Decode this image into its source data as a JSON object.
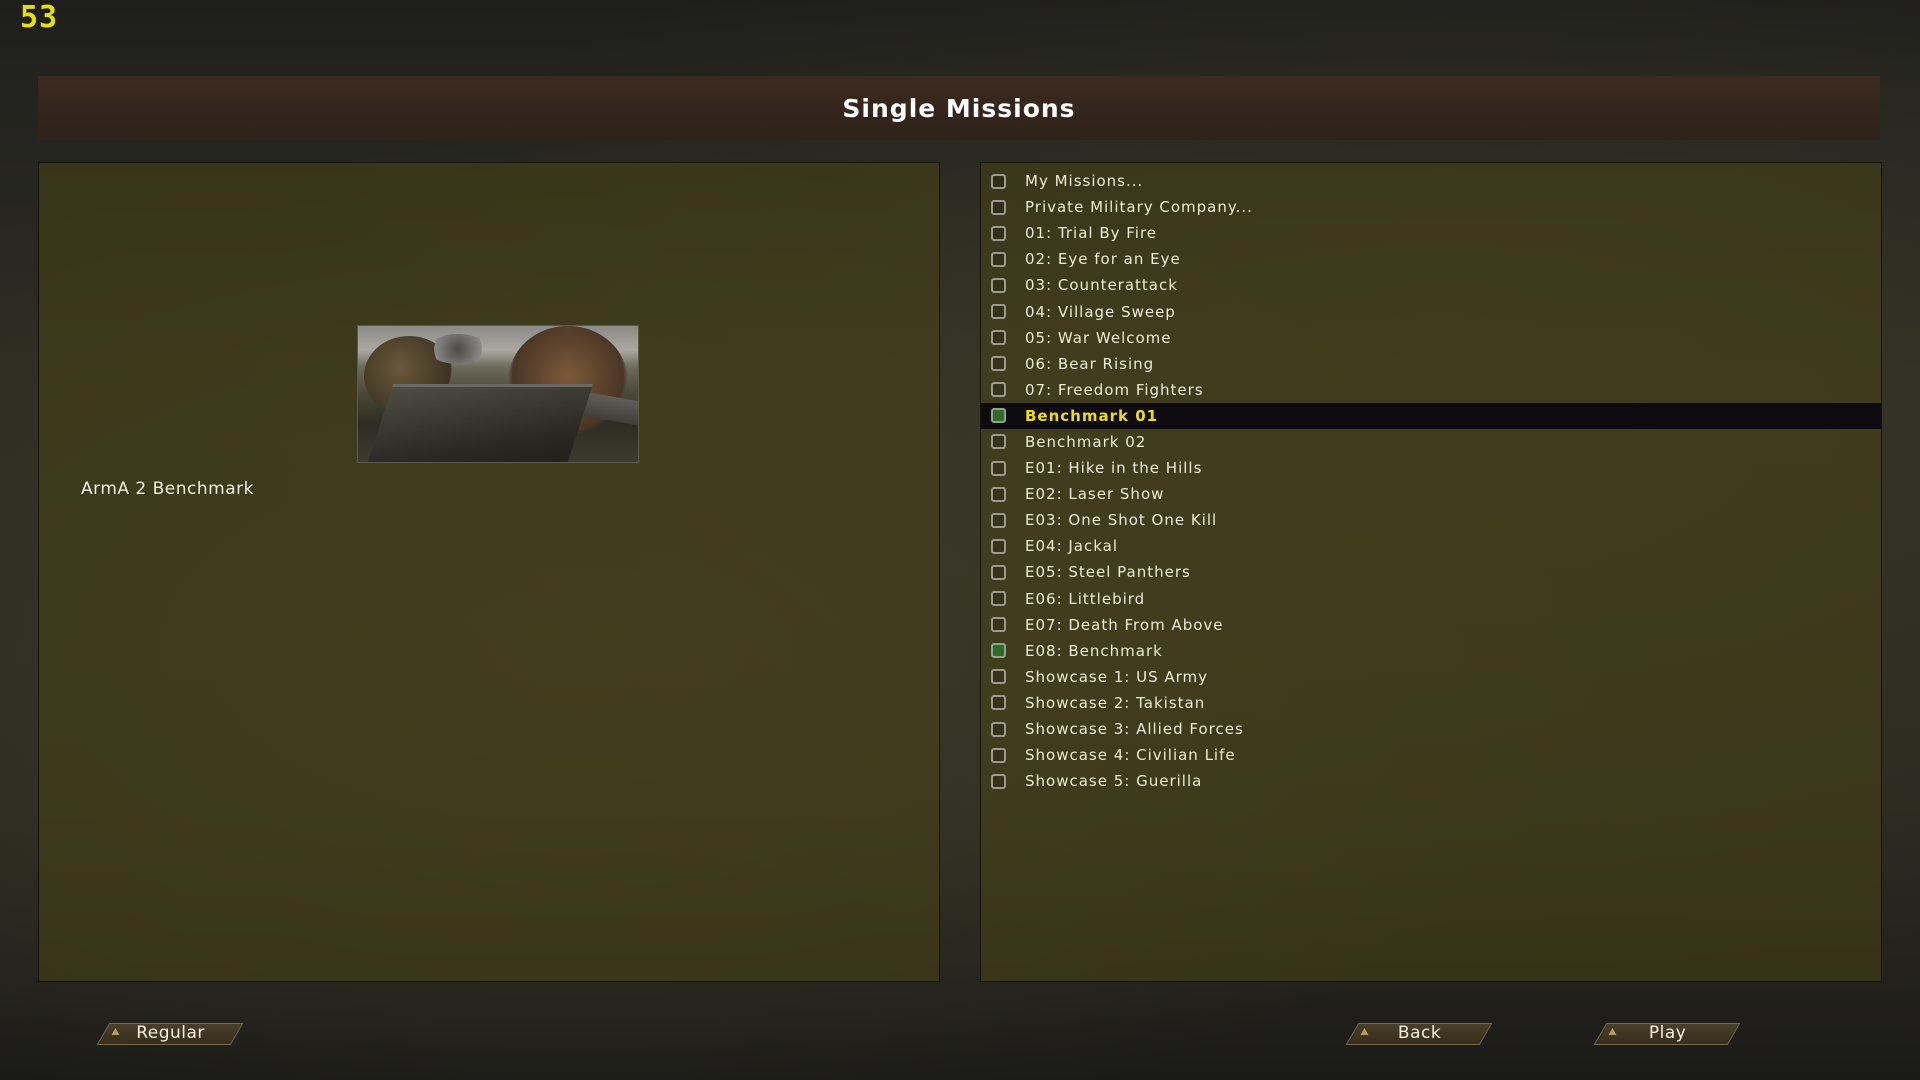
{
  "fps": "53",
  "title": "Single Missions",
  "left_panel": {
    "mission_description": "ArmA 2 Benchmark"
  },
  "missions": [
    {
      "label": "My Missions...",
      "completed": false,
      "selected": false
    },
    {
      "label": "Private Military Company...",
      "completed": false,
      "selected": false
    },
    {
      "label": "01: Trial By Fire",
      "completed": false,
      "selected": false
    },
    {
      "label": "02: Eye for an Eye",
      "completed": false,
      "selected": false
    },
    {
      "label": "03: Counterattack",
      "completed": false,
      "selected": false
    },
    {
      "label": "04: Village Sweep",
      "completed": false,
      "selected": false
    },
    {
      "label": "05: War Welcome",
      "completed": false,
      "selected": false
    },
    {
      "label": "06: Bear Rising",
      "completed": false,
      "selected": false
    },
    {
      "label": "07: Freedom Fighters",
      "completed": false,
      "selected": false
    },
    {
      "label": "Benchmark 01",
      "completed": true,
      "selected": true
    },
    {
      "label": "Benchmark 02",
      "completed": false,
      "selected": false
    },
    {
      "label": "E01: Hike in the Hills",
      "completed": false,
      "selected": false
    },
    {
      "label": "E02: Laser Show",
      "completed": false,
      "selected": false
    },
    {
      "label": "E03: One Shot One Kill",
      "completed": false,
      "selected": false
    },
    {
      "label": "E04: Jackal",
      "completed": false,
      "selected": false
    },
    {
      "label": "E05: Steel Panthers",
      "completed": false,
      "selected": false
    },
    {
      "label": "E06: Littlebird",
      "completed": false,
      "selected": false
    },
    {
      "label": "E07: Death From Above",
      "completed": false,
      "selected": false
    },
    {
      "label": "E08: Benchmark",
      "completed": true,
      "selected": false
    },
    {
      "label": "Showcase 1: US Army",
      "completed": false,
      "selected": false
    },
    {
      "label": "Showcase 2: Takistan",
      "completed": false,
      "selected": false
    },
    {
      "label": "Showcase 3: Allied Forces",
      "completed": false,
      "selected": false
    },
    {
      "label": "Showcase 4: Civilian Life",
      "completed": false,
      "selected": false
    },
    {
      "label": "Showcase 5: Guerilla",
      "completed": false,
      "selected": false
    }
  ],
  "buttons": {
    "difficulty": "Regular",
    "back": "Back",
    "play": "Play"
  },
  "colors": {
    "fps_color": "#e8e000",
    "selected_text": "#efe000",
    "completed_check": "#2f6a2a"
  }
}
